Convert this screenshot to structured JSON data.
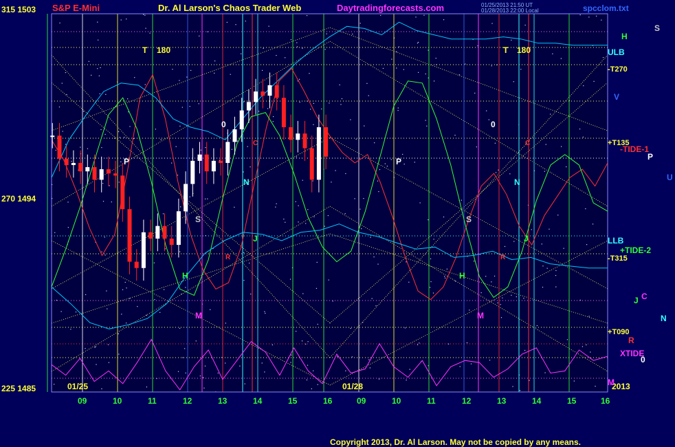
{
  "header": {
    "left_label": "S&P E-Mini",
    "center_title": "Dr. Al Larson's Chaos Trader Web",
    "site": "Daytradingforecasts.com",
    "file": "spcclom.txt",
    "timestamp_line1": "01/25/2013 21:50 UT",
    "timestamp_line2": "01/28/2013 22:00 Local"
  },
  "footer": {
    "copyright": "Copyright 2013, Dr. Al Larson. May not be copied by any means."
  },
  "colors": {
    "background": "#00005a",
    "plot_bg": "#000040",
    "yellow": "#ffff33",
    "red": "#ff3030",
    "green": "#33ff33",
    "cyan": "#33ffff",
    "magenta": "#ff33ff"
  },
  "chart_data": {
    "type": "line",
    "title": "S&P E-Mini",
    "y_axis_left": [
      {
        "label": "315",
        "price": "1503"
      },
      {
        "label": "270",
        "price": "1494"
      },
      {
        "label": "225",
        "price": "1485"
      }
    ],
    "ylim": [
      1485,
      1503
    ],
    "x_days": [
      "01/25",
      "01/28"
    ],
    "x_year": "2013",
    "x_ticks_day1": [
      "09",
      "10",
      "11",
      "12",
      "13",
      "14",
      "15",
      "16"
    ],
    "x_ticks_day2": [
      "09",
      "10",
      "11",
      "12",
      "13",
      "14",
      "15",
      "16"
    ],
    "right_labels": [
      "H",
      "S",
      "ULB",
      "-T270",
      "V",
      "+T135",
      "-TIDE-1",
      "P",
      "U",
      "LLB",
      "+TIDE-2",
      "-T315",
      "J",
      "C",
      "N",
      "+T090",
      "R",
      "XTIDE",
      "0",
      "M"
    ],
    "in_chart_labels": [
      "T",
      "180",
      "T",
      "180",
      "0",
      "0",
      "P",
      "P",
      "N",
      "N",
      "S",
      "S",
      "H",
      "H",
      "J",
      "J",
      "M",
      "M",
      "C",
      "C",
      "R",
      "R"
    ],
    "price_series": {
      "name": "S&P E-Mini 5-min",
      "x_hours": [
        8.3,
        8.5,
        8.7,
        8.9,
        9.1,
        9.3,
        9.5,
        9.7,
        9.9,
        10.1,
        10.3,
        10.5,
        10.7,
        10.9,
        11.1,
        11.3,
        11.5,
        11.7,
        11.9,
        12.1,
        12.3,
        12.5,
        12.7,
        12.9,
        13.1,
        13.3,
        13.5,
        13.7,
        13.9,
        14.1,
        14.3,
        14.5,
        14.7,
        14.9,
        15.1,
        15.3,
        15.5,
        15.7,
        15.9,
        16.1
      ],
      "close": [
        1497.2,
        1496.1,
        1495.8,
        1495.9,
        1495.5,
        1495.7,
        1495.1,
        1495.6,
        1495.4,
        1495.3,
        1493.7,
        1491.2,
        1490.9,
        1492.6,
        1492.3,
        1492.9,
        1492.3,
        1492.0,
        1493.6,
        1494.9,
        1496.0,
        1496.3,
        1495.5,
        1496.0,
        1495.9,
        1496.9,
        1497.5,
        1498.4,
        1498.8,
        1499.3,
        1499.1,
        1499.6,
        1499.0,
        1497.6,
        1497.0,
        1497.3,
        1496.6,
        1495.1,
        1497.6,
        1496.2
      ]
    },
    "series_lines": [
      {
        "color": "#ff3030",
        "y": [
          1497.0,
          1496.0,
          1494.5,
          1492.8,
          1491.5,
          1492.5,
          1495.5,
          1499.0,
          1500.1,
          1498.0,
          1495.0,
          1492.5,
          1490.8,
          1489.9,
          1490.2,
          1491.9,
          1494.8,
          1497.6,
          1499.8,
          1500.4,
          1499.3,
          1498.1,
          1497.2,
          1496.4,
          1495.9,
          1496.3,
          1495.0,
          1493.3,
          1491.4,
          1489.8,
          1489.4,
          1490.0,
          1491.4,
          1493.2,
          1494.8,
          1495.4,
          1494.4,
          1492.9,
          1492.0,
          1493.4,
          1494.3,
          1495.2,
          1495.6,
          1494.8,
          1495.9
        ]
      },
      {
        "color": "#33ff33",
        "y": [
          1490.0,
          1491.8,
          1493.8,
          1496.0,
          1498.2,
          1499.0,
          1497.5,
          1495.0,
          1492.0,
          1489.9,
          1489.6,
          1491.3,
          1494.2,
          1496.8,
          1498.1,
          1498.3,
          1497.2,
          1495.4,
          1493.3,
          1491.9,
          1491.2,
          1491.7,
          1493.6,
          1496.1,
          1498.6,
          1499.8,
          1499.7,
          1498.0,
          1495.8,
          1493.0,
          1490.5,
          1489.5,
          1490.0,
          1491.7,
          1494.1,
          1495.8,
          1496.3,
          1495.8,
          1494.0,
          1493.6
        ]
      },
      {
        "color": "#00c8ff",
        "y": [
          1495.2,
          1497.0,
          1498.2,
          1499.3,
          1499.7,
          1499.6,
          1499.0,
          1498.0,
          1497.6,
          1497.4,
          1497.0,
          1498.0,
          1499.0,
          1499.8,
          1500.6,
          1501.3,
          1501.9,
          1502.4,
          1502.3,
          1502.0,
          1502.6,
          1502.2,
          1502.0,
          1501.8,
          1501.8,
          1501.8,
          1501.9,
          1501.8,
          1501.6,
          1501.6,
          1501.5,
          1501.5,
          1501.5
        ]
      },
      {
        "color": "#00c8ff",
        "y": [
          1490.0,
          1489.2,
          1488.3,
          1488.0,
          1488.2,
          1488.5,
          1489.2,
          1490.5,
          1491.6,
          1492.2,
          1492.6,
          1492.5,
          1492.2,
          1492.6,
          1492.7,
          1493.0,
          1492.6,
          1492.4,
          1492.1,
          1491.8,
          1491.9,
          1491.4,
          1491.5,
          1491.7,
          1491.3,
          1491.4,
          1491.1,
          1491.0,
          1490.9,
          1490.9
        ]
      },
      {
        "color": "#ff33ff",
        "y": [
          1486.3,
          1485.8,
          1486.6,
          1485.5,
          1486.0,
          1485.4,
          1486.4,
          1487.5,
          1486.0,
          1485.1,
          1486.2,
          1487.0,
          1485.6,
          1486.5,
          1487.4,
          1486.9,
          1485.8,
          1487.1,
          1486.0,
          1485.4,
          1486.8,
          1485.9,
          1486.1,
          1487.3,
          1486.2,
          1485.7,
          1486.5,
          1485.3,
          1486.2,
          1486.5,
          1486.4,
          1485.7,
          1486.1,
          1486.8,
          1487.1,
          1485.9,
          1486.0,
          1487.0,
          1486.5,
          1486.7
        ]
      }
    ],
    "grid": true,
    "legend": "right"
  }
}
